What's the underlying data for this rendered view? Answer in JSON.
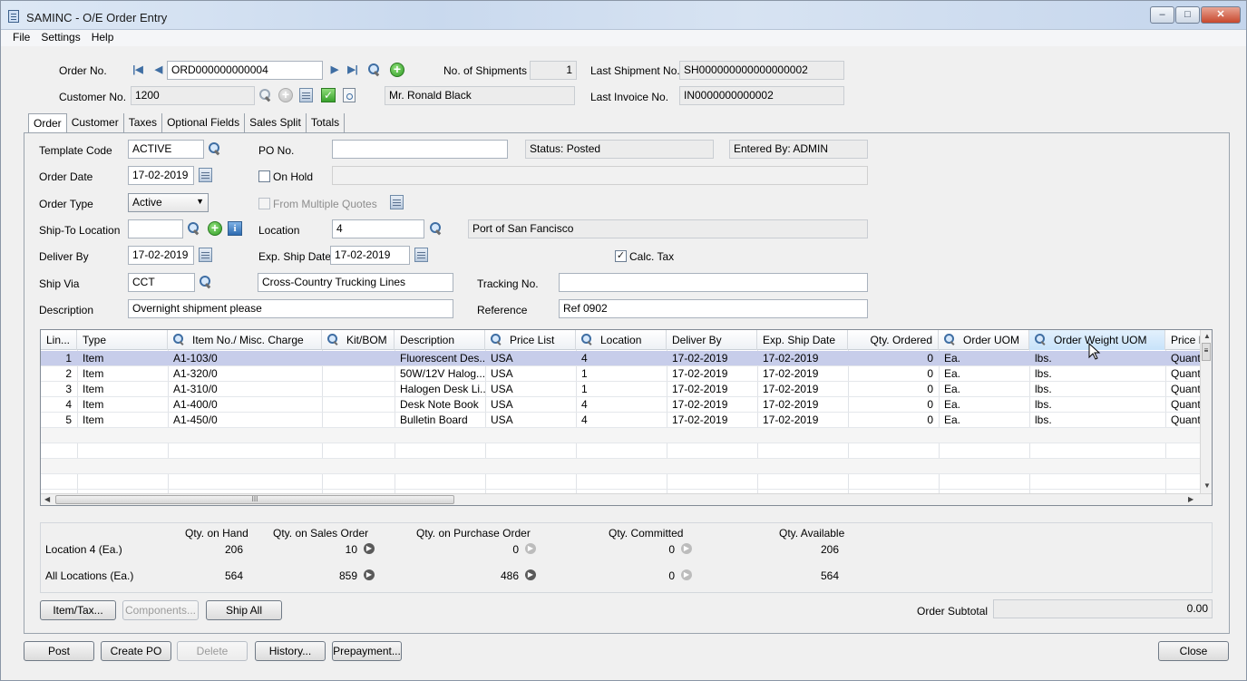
{
  "window": {
    "title": "SAMINC - O/E Order Entry",
    "controls": {
      "minimize": "–",
      "maximize": "□",
      "close": "✕"
    }
  },
  "menu": [
    "File",
    "Settings",
    "Help"
  ],
  "header": {
    "order_no_label": "Order No.",
    "order_no": "ORD000000000004",
    "shipments_label": "No. of Shipments",
    "shipments": "1",
    "last_shipment_label": "Last Shipment No.",
    "last_shipment": "SH000000000000000002",
    "customer_no_label": "Customer No.",
    "customer_no": "1200",
    "customer_name": "Mr. Ronald Black",
    "last_invoice_label": "Last Invoice No.",
    "last_invoice": "IN0000000000002"
  },
  "tabs": [
    {
      "label": "Order",
      "active": true
    },
    {
      "label": "Customer",
      "active": false
    },
    {
      "label": "Taxes",
      "active": false
    },
    {
      "label": "Optional Fields",
      "active": false
    },
    {
      "label": "Sales Split",
      "active": false
    },
    {
      "label": "Totals",
      "active": false
    }
  ],
  "form": {
    "template_code_label": "Template Code",
    "template_code": "ACTIVE",
    "po_no_label": "PO No.",
    "po_no": "",
    "status": "Status: Posted",
    "entered_by": "Entered By: ADMIN",
    "order_date_label": "Order Date",
    "order_date": "17-02-2019",
    "on_hold_label": "On Hold",
    "on_hold_reason": "",
    "order_type_label": "Order Type",
    "order_type": "Active",
    "from_quotes_label": "From Multiple Quotes",
    "ship_to_label": "Ship-To Location",
    "ship_to": "",
    "location_label": "Location",
    "location": "4",
    "location_desc": "Port of San Fancisco",
    "deliver_by_label": "Deliver By",
    "deliver_by": "17-02-2019",
    "exp_ship_label": "Exp. Ship Date",
    "exp_ship": "17-02-2019",
    "calc_tax_label": "Calc. Tax",
    "calc_tax_checked": "✓",
    "ship_via_label": "Ship Via",
    "ship_via": "CCT",
    "ship_via_desc": "Cross-Country Trucking Lines",
    "tracking_label": "Tracking No.",
    "tracking": "",
    "description_label": "Description",
    "description": "Overnight shipment please",
    "reference_label": "Reference",
    "reference": "Ref 0902"
  },
  "grid": {
    "columns": [
      "Lin...",
      "Type",
      "Item No./ Misc. Charge",
      "Kit/BOM",
      "Description",
      "Price List",
      "Location",
      "Deliver By",
      "Exp. Ship Date",
      "Qty. Ordered",
      "Order UOM",
      "Order Weight UOM",
      "Price E"
    ],
    "rows": [
      [
        "1",
        "Item",
        "A1-103/0",
        "",
        "Fluorescent Des...",
        "USA",
        "4",
        "17-02-2019",
        "17-02-2019",
        "0",
        "Ea.",
        "lbs.",
        "Quanti"
      ],
      [
        "2",
        "Item",
        "A1-320/0",
        "",
        "50W/12V Halog...",
        "USA",
        "1",
        "17-02-2019",
        "17-02-2019",
        "0",
        "Ea.",
        "lbs.",
        "Quanti"
      ],
      [
        "3",
        "Item",
        "A1-310/0",
        "",
        "Halogen Desk Li...",
        "USA",
        "1",
        "17-02-2019",
        "17-02-2019",
        "0",
        "Ea.",
        "lbs.",
        "Quanti"
      ],
      [
        "4",
        "Item",
        "A1-400/0",
        "",
        "Desk Note Book",
        "USA",
        "4",
        "17-02-2019",
        "17-02-2019",
        "0",
        "Ea.",
        "lbs.",
        "Quanti"
      ],
      [
        "5",
        "Item",
        "A1-450/0",
        "",
        "Bulletin Board",
        "USA",
        "4",
        "17-02-2019",
        "17-02-2019",
        "0",
        "Ea.",
        "lbs.",
        "Quanti"
      ]
    ],
    "hscroll_grip": "III"
  },
  "summary": {
    "headers": [
      "Qty. on Hand",
      "Qty. on Sales Order",
      "Qty. on Purchase Order",
      "Qty. Committed",
      "Qty. Available"
    ],
    "row1_label": "Location  4 (Ea.)",
    "row1": [
      "206",
      "10",
      "0",
      "0",
      "206"
    ],
    "row2_label": "All Locations (Ea.)",
    "row2": [
      "564",
      "859",
      "486",
      "0",
      "564"
    ]
  },
  "buttons": {
    "item_tax": "Item/Tax...",
    "components": "Components...",
    "ship_all": "Ship All",
    "subtotal_label": "Order Subtotal",
    "subtotal": "0.00",
    "post": "Post",
    "create_po": "Create PO",
    "delete": "Delete",
    "history": "History...",
    "prepayment": "Prepayment...",
    "close": "Close"
  }
}
